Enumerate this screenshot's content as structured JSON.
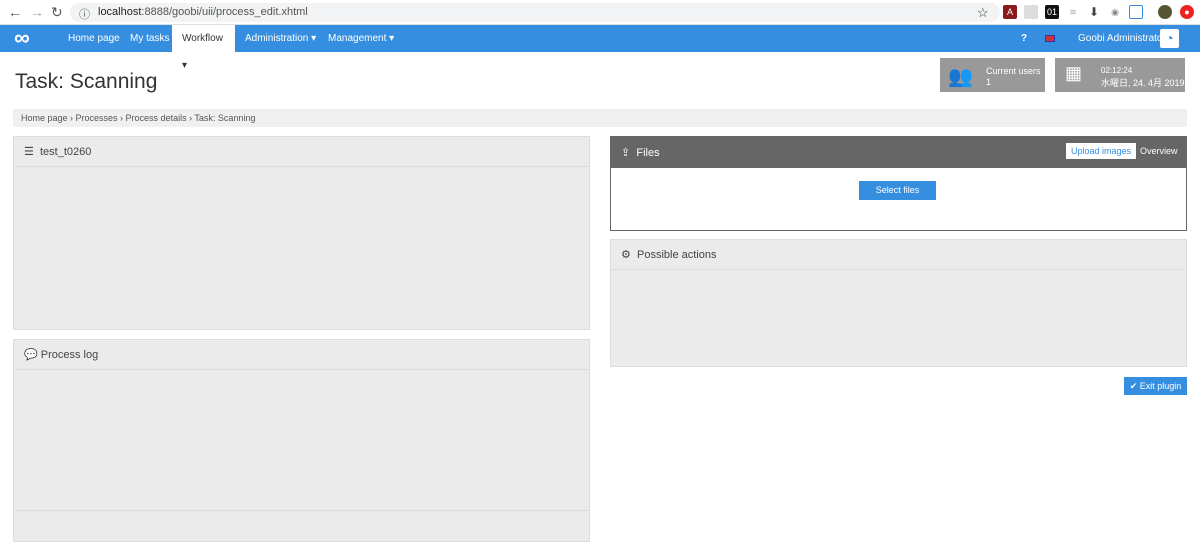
{
  "browser": {
    "url_host": "localhost",
    "url_rest": ":8888/goobi/uii/process_edit.xhtml"
  },
  "nav": {
    "items": [
      "Home page",
      "My tasks",
      "Workflow ▾",
      "Administration ▾",
      "Management ▾"
    ],
    "help": "?",
    "user": "Goobi Administrator"
  },
  "header": {
    "title": "Task: Scanning",
    "users_label": "Current users",
    "users_count": "1",
    "time": "02:12:24",
    "date": "水曜日, 24. 4月 2019"
  },
  "breadcrumb": "Home page  ›  Processes  ›  Process details  ›  Task: Scanning",
  "panels": {
    "process": "test_t0260",
    "log": "Process log",
    "files": "Files",
    "upload": "Upload images",
    "overview": "Overview",
    "select": "Select files",
    "actions": "Possible actions",
    "exit": "Exit plugin"
  },
  "colors": {
    "brand": "#368ee0",
    "files_header": "#666666"
  }
}
